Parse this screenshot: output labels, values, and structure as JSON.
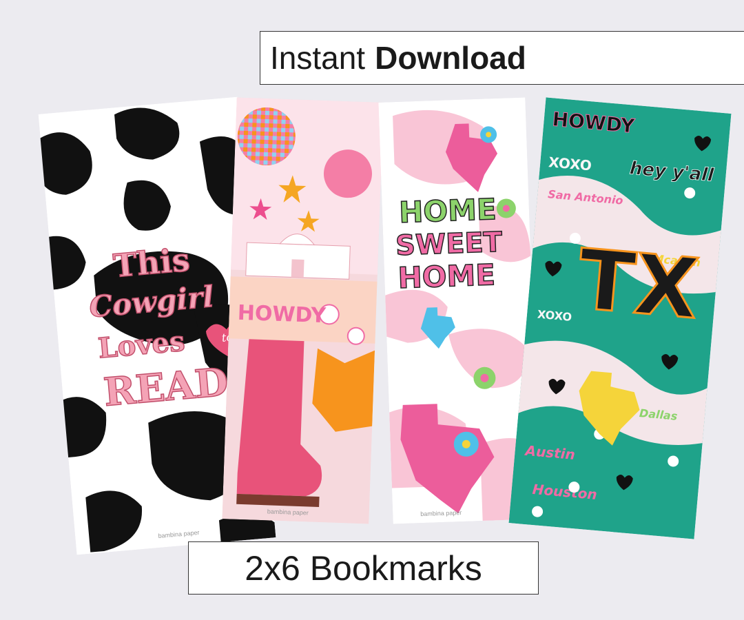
{
  "header": {
    "word1": "Instant",
    "word2": "Download"
  },
  "footer": {
    "label": "2x6 Bookmarks"
  },
  "colors": {
    "background": "#ecebf0",
    "pink": "#f06ba5",
    "cowblack": "#111111",
    "teal": "#1fa38a"
  },
  "bookmarks": [
    {
      "name": "cow-print",
      "lines": [
        "This",
        "Cowgirl",
        "Loves",
        "to",
        "READ"
      ],
      "credit": "bambina paper"
    },
    {
      "name": "alamo-boot",
      "lines": [
        "HOWDY"
      ],
      "credit": "bambina paper"
    },
    {
      "name": "home-sweet-home",
      "lines": [
        "HOME",
        "SWEET",
        "HOME"
      ],
      "credit": "bambina paper"
    },
    {
      "name": "texas-cities",
      "lines": [
        "HOWDY",
        "XOXO",
        "hey y'all",
        "San Antonio",
        "Mcallen",
        "TX",
        "XOXO",
        "Dallas",
        "Austin",
        "Houston"
      ]
    }
  ]
}
